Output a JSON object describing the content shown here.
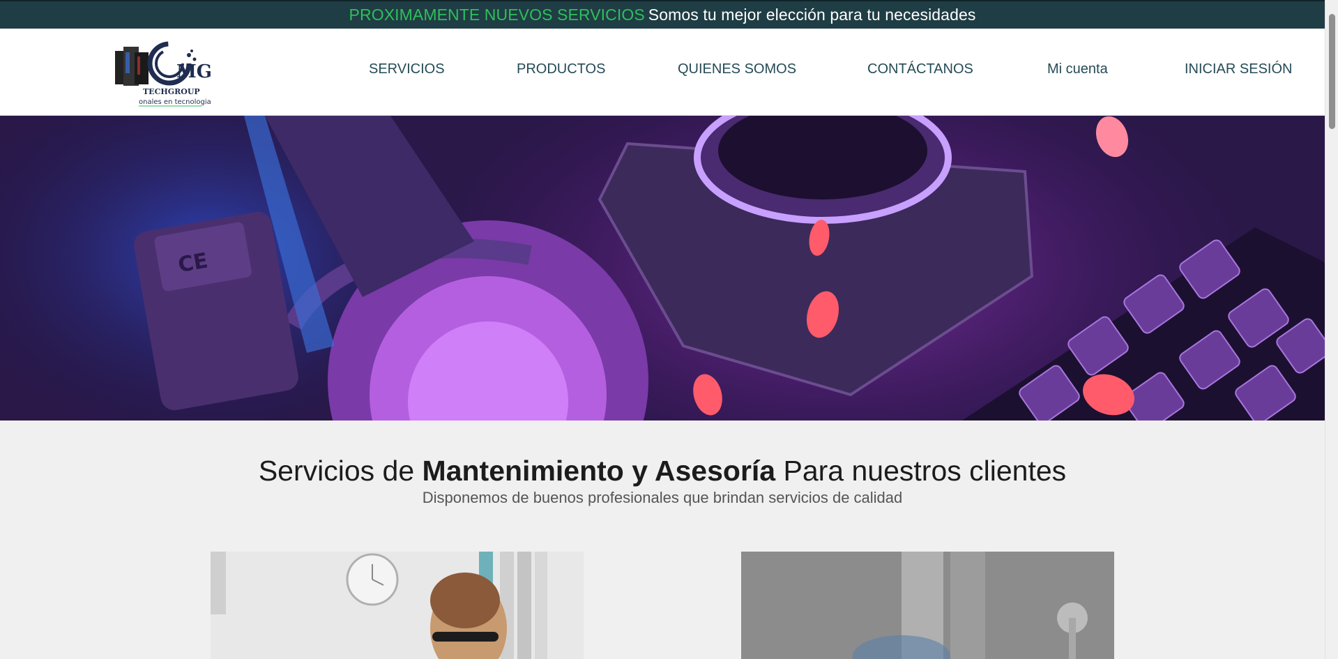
{
  "announcement": {
    "accent": "PROXIMAMENTE NUEVOS SERVICIOS",
    "message": "Somos tu mejor elección para tu necesidades"
  },
  "logo": {
    "mark": "MG",
    "brand": "TECHGROUP",
    "tagline": "onales en tecnologia"
  },
  "nav": [
    {
      "label": "SERVICIOS"
    },
    {
      "label": "PRODUCTOS"
    },
    {
      "label": "QUIENES SOMOS"
    },
    {
      "label": "CONTÁCTANOS"
    },
    {
      "label": "Mi cuenta"
    },
    {
      "label": "INICIAR SESIÓN"
    }
  ],
  "slider": {
    "slide_count": 3,
    "active_slide": 2,
    "label_ce": "CE"
  },
  "services": {
    "title_pre": "Servicios de ",
    "title_bold": "Mantenimiento y Asesoría",
    "title_post": " Para nuestros clientes",
    "subtitle": "Disponemos de buenos profesionales que brindan servicios de calidad"
  },
  "colors": {
    "topbar_bg": "#1f3d44",
    "accent_green": "#2fbf5b",
    "nav_text": "#254b56"
  }
}
